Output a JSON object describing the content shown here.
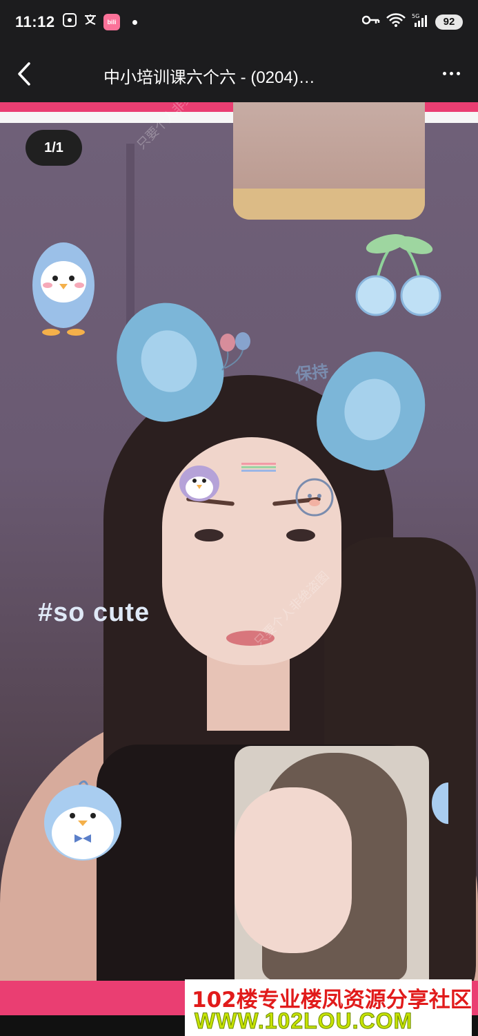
{
  "status_bar": {
    "time": "11:12",
    "left_icons": [
      "screenshot-icon",
      "translate-icon",
      "bilibili-app-icon",
      "notification-dot"
    ],
    "battery": "92",
    "network": "5G"
  },
  "nav": {
    "title": "中小培训课六个六 - (0204)…",
    "back_icon": "chevron-left-icon",
    "more_icon": "more-dots-icon"
  },
  "viewer": {
    "counter": "1/1",
    "hashtag": "#so cute",
    "face_sticker_text": "保持",
    "watermark": "只要个人非绝盗图"
  },
  "banner": {
    "line1": "102楼专业楼凤资源分享社区",
    "line2": "WWW.102LOU.COM",
    "colors": {
      "line1": "#e11b1b",
      "line2": "#c7e300"
    }
  },
  "colors": {
    "accent_pink": "#ea3e72",
    "toolbar": "#1c1c1e"
  }
}
